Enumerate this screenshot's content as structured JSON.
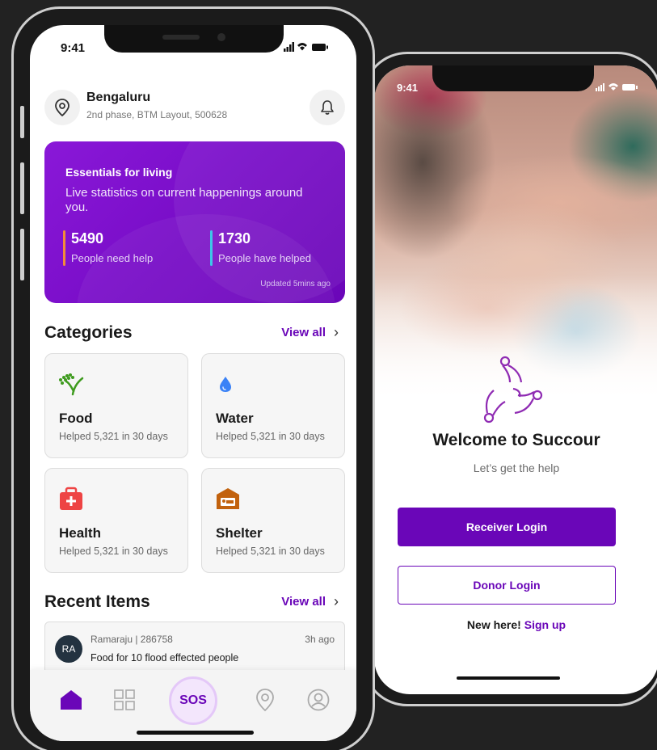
{
  "phone_main": {
    "status": {
      "time": "9:41"
    },
    "location": {
      "city": "Bengaluru",
      "address": "2nd phase, BTM Layout, 500628"
    },
    "stats_card": {
      "title": "Essentials for living",
      "subtitle": "Live statistics on current happenings around you.",
      "need_help_value": "5490",
      "need_help_label": "People need help",
      "have_helped_value": "1730",
      "have_helped_label": "People have helped",
      "updated": "Updated 5mins ago",
      "colors": {
        "need_help_bar": "#f28c3a",
        "have_helped_bar": "#3ec7e8"
      }
    },
    "categories_section": {
      "title": "Categories",
      "view_all": "View all"
    },
    "categories": [
      {
        "name": "Food",
        "helped": "Helped 5,321 in 30 days",
        "icon": "wheat-icon"
      },
      {
        "name": "Water",
        "helped": "Helped 5,321 in 30 days",
        "icon": "water-drop-icon"
      },
      {
        "name": "Health",
        "helped": "Helped 5,321 in 30 days",
        "icon": "first-aid-icon"
      },
      {
        "name": "Shelter",
        "helped": "Helped 5,321 in 30 days",
        "icon": "bed-icon"
      }
    ],
    "recent_section": {
      "title": "Recent Items",
      "view_all": "View all"
    },
    "recent_items": [
      {
        "initials": "RA",
        "meta": "Ramaraju | 286758",
        "time": "3h ago",
        "text": "Food for 10 flood effected people"
      }
    ],
    "nav": {
      "items": [
        "home-icon",
        "grid-icon",
        "sos-button",
        "location-pin-icon",
        "profile-icon"
      ],
      "sos_label": "SOS"
    }
  },
  "phone_welcome": {
    "status": {
      "time": "9:41"
    },
    "title": "Welcome to Succour",
    "tagline": "Let’s get the help",
    "receiver_button": "Receiver Login",
    "donor_button": "Donor Login",
    "signup_prompt": "New here!",
    "signup_link": "Sign up"
  },
  "colors": {
    "brand": "#6a06b8",
    "background": "#222222"
  }
}
